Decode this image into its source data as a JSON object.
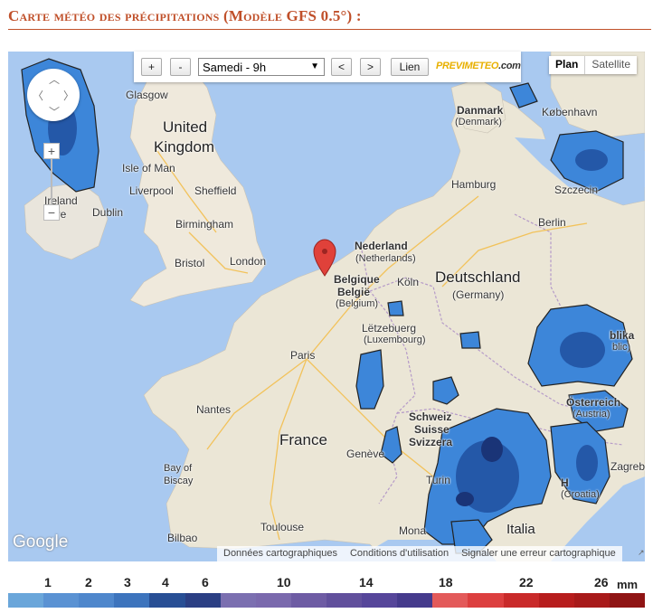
{
  "title": "Carte météo des précipitations (Modèle GFS 0.5°) :",
  "toolbar": {
    "zoom_in": "+",
    "zoom_out": "-",
    "time_select": "Samedi - 9h",
    "prev": "<",
    "next": ">",
    "link": "Lien",
    "brand_main": "PREVIMETEO",
    "brand_suffix": ".com"
  },
  "map_type": {
    "plan": "Plan",
    "satellite": "Satellite"
  },
  "zoom": {
    "plus": "+",
    "minus": "−"
  },
  "labels": {
    "glasgow": "Glasgow",
    "uk1": "United",
    "uk2": "Kingdom",
    "isle_of_man": "Isle of Man",
    "ireland": "Ireland",
    "eire": "Éire",
    "dublin": "Dublin",
    "liverpool": "Liverpool",
    "sheffield": "Sheffield",
    "birmingham": "Birmingham",
    "bristol": "Bristol",
    "london": "London",
    "paris": "Paris",
    "nantes": "Nantes",
    "france": "France",
    "bay1": "Bay of",
    "bay2": "Biscay",
    "bilbao": "Bilbao",
    "toulouse": "Toulouse",
    "geneve": "Genève",
    "turin": "Turin",
    "monaco": "Mona",
    "italia": "Italia",
    "schweiz1": "Schweiz",
    "schweiz2": "Suisse",
    "schweiz3": "Svizzera",
    "nederland1": "Nederland",
    "nederland2": "(Netherlands)",
    "belgique1": "Belgique",
    "belgique2": "België",
    "belgique3": "(Belgium)",
    "koln": "Köln",
    "luxembourg1": "Lëtzebuerg",
    "luxembourg2": "(Luxembourg)",
    "deutschland": "Deutschland",
    "germany": "(Germany)",
    "hamburg": "Hamburg",
    "berlin": "Berlin",
    "danmark1": "Danmark",
    "danmark2": "(Denmark)",
    "kobenhavn": "København",
    "szczecin": "Szczecin",
    "osterreich1": "Österreich",
    "osterreich2": "(Austria)",
    "zagreb": "Zagreb",
    "hr": "H",
    "croatia": "(Croatia)",
    "cz": "blika",
    "cz2": "blic)"
  },
  "attribution": {
    "data": "Données cartographiques",
    "terms": "Conditions d'utilisation",
    "report": "Signaler une erreur cartographique"
  },
  "google_logo": "Google",
  "scale": {
    "labels": [
      "1",
      "2",
      "3",
      "4",
      "6",
      "10",
      "14",
      "18",
      "22",
      "26"
    ],
    "unit": "mm",
    "colors": [
      "#6aa6da",
      "#5a92d3",
      "#4f87cc",
      "#3d74bd",
      "#284f95",
      "#2b3f84",
      "#7b6fb0",
      "#7a69ad",
      "#6e5ca4",
      "#61509c",
      "#56469a",
      "#453a8c",
      "#e35a5a",
      "#dc3f3f",
      "#c92a2a",
      "#b71d1d",
      "#a81a1a",
      "#8f1414"
    ]
  }
}
